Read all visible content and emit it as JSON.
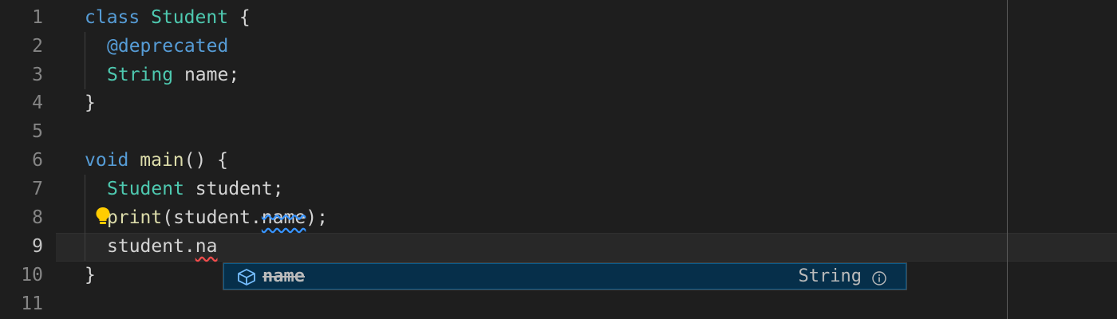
{
  "editor": {
    "line_numbers": [
      "1",
      "2",
      "3",
      "4",
      "5",
      "6",
      "7",
      "8",
      "9",
      "10",
      "11"
    ],
    "active_line": "9",
    "lines": {
      "l1": {
        "kw": "class",
        "type": "Student",
        "rest": " {"
      },
      "l2": {
        "annotation": "@deprecated"
      },
      "l3": {
        "type": "String",
        "rest": " name;"
      },
      "l4": {
        "rest": "}"
      },
      "l6": {
        "kw": "void",
        "fn": "main",
        "rest": "() {"
      },
      "l7": {
        "type": "Student",
        "rest": " student;"
      },
      "l8": {
        "fn": "print",
        "pre": "(student.",
        "deprecated": "name",
        "post": ");"
      },
      "l9": {
        "pre": "student.",
        "typed": "na"
      },
      "l10": {
        "rest": "}"
      }
    }
  },
  "suggest": {
    "item_label": "name",
    "item_detail": "String",
    "item_icon": "field-icon"
  },
  "colors": {
    "keyword": "#569cd6",
    "type": "#4ec9b0",
    "function": "#dcdcaa",
    "text": "#d4d4d4",
    "background": "#1e1e1e",
    "lightbulb": "#ffcc00"
  }
}
